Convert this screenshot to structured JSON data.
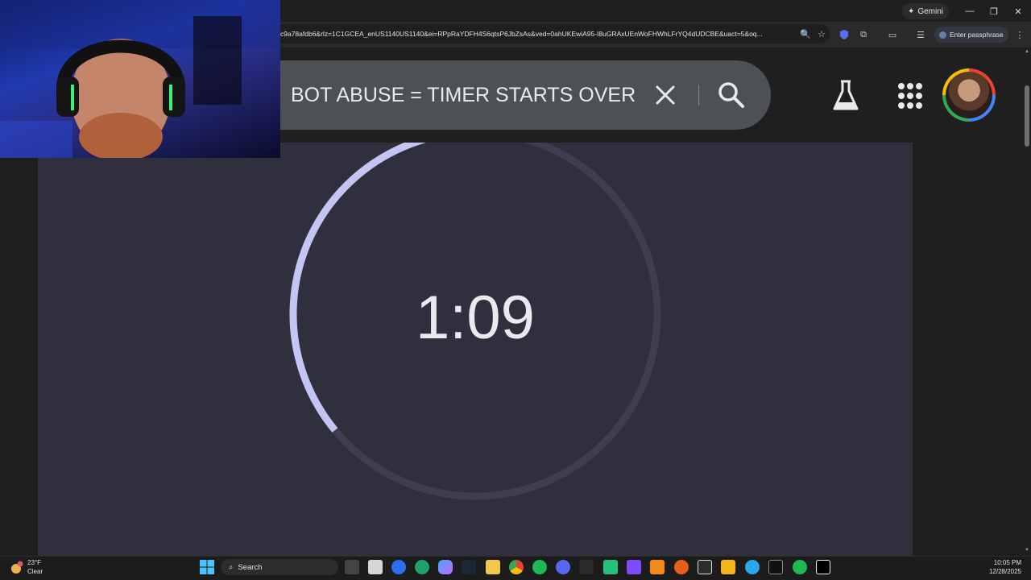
{
  "browser": {
    "gemini_label": "Gemini",
    "url": "c9a78afdb6&rlz=1C1GCEA_enUS1140US1140&ei=RPpRaYDFH4S6qtsP6JbZsAs&ved=0ahUKEwiA95-I8uGRAxUEnWoFHWhLFrYQ4dUDCBE&uact=5&oq...",
    "passphrase_label": "Enter passphrase"
  },
  "search": {
    "query": "BOT ABUSE = TIMER STARTS OVER"
  },
  "timer": {
    "display": "1:09",
    "progress_remaining": 0.36,
    "track_color": "#3e3e50",
    "progress_color": "#c3c5f5"
  },
  "taskbar": {
    "weather_temp": "23°F",
    "weather_condition": "Clear",
    "search_label": "Search",
    "time": "10:05 PM",
    "date": "12/28/2025"
  },
  "icons": {
    "titlebar": [
      "sparkle-icon",
      "minimize-icon",
      "restore-icon",
      "close-icon"
    ],
    "toolbar": [
      "zoom-icon",
      "star-icon",
      "extension-shield-icon",
      "extensions-icon",
      "cast-icon",
      "reading-list-icon",
      "profile-icon",
      "more-icon"
    ],
    "taskbar_apps": [
      "task-view-icon",
      "store-icon",
      "meta-icon",
      "edge-icon",
      "copilot-icon",
      "steam-icon",
      "file-explorer-icon",
      "chrome-icon",
      "spotify-icon",
      "discord-icon",
      "ghub-icon",
      "app-green-icon",
      "app-purple-icon",
      "vlc-icon",
      "app-orange-icon",
      "epic-games-icon",
      "rockstar-icon",
      "telegram-icon",
      "capcut-icon",
      "spotify-green-icon",
      "x-icon"
    ]
  }
}
